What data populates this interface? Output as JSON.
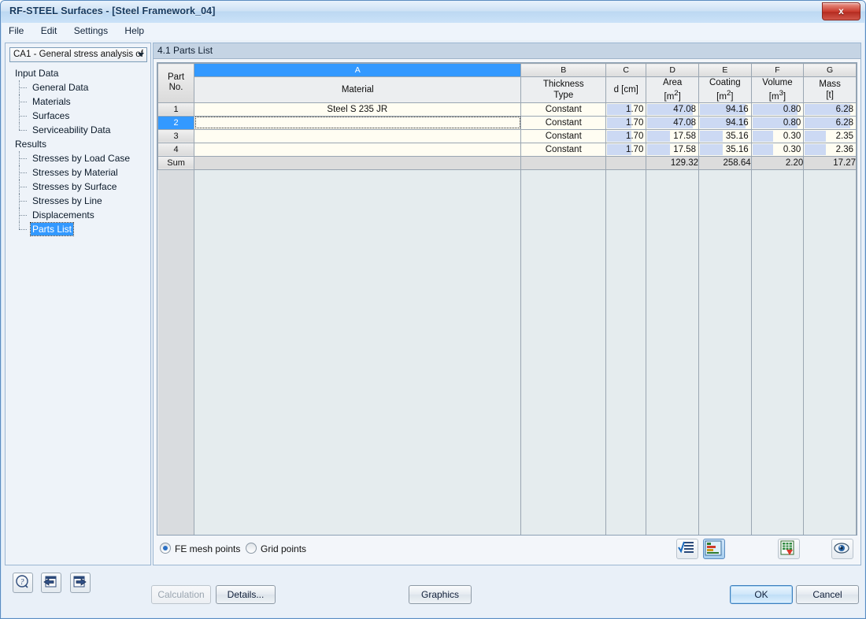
{
  "window": {
    "title": "RF-STEEL Surfaces - [Steel Framework_04]",
    "close_label": "x"
  },
  "menubar": {
    "items": [
      {
        "label": "File"
      },
      {
        "label": "Edit"
      },
      {
        "label": "Settings"
      },
      {
        "label": "Help"
      }
    ]
  },
  "sidebar": {
    "combo": {
      "value": "CA1 - General stress analysis of",
      "icon": "chevron-down-icon"
    },
    "tree": [
      {
        "label": "Input Data",
        "type": "root"
      },
      {
        "label": "General Data",
        "type": "child"
      },
      {
        "label": "Materials",
        "type": "child"
      },
      {
        "label": "Surfaces",
        "type": "child"
      },
      {
        "label": "Serviceability Data",
        "type": "child",
        "last": true
      },
      {
        "label": "Results",
        "type": "root"
      },
      {
        "label": "Stresses by Load Case",
        "type": "child"
      },
      {
        "label": "Stresses by Material",
        "type": "child"
      },
      {
        "label": "Stresses by Surface",
        "type": "child"
      },
      {
        "label": "Stresses by Line",
        "type": "child"
      },
      {
        "label": "Displacements",
        "type": "child"
      },
      {
        "label": "Parts List",
        "type": "child",
        "selected": true,
        "last": true
      }
    ],
    "buttons": [
      {
        "name": "help-button",
        "icon": "question-mark-icon"
      },
      {
        "name": "previous-button",
        "icon": "arrow-left-icon"
      },
      {
        "name": "next-button",
        "icon": "arrow-right-icon"
      }
    ]
  },
  "content": {
    "title": "4.1 Parts List",
    "table": {
      "column_letters": [
        "A",
        "B",
        "C",
        "D",
        "E",
        "F",
        "G"
      ],
      "selected_column_letter": "A",
      "row_header": {
        "line1": "Part",
        "line2": "No."
      },
      "headers": [
        {
          "line1": "",
          "line2": "Material"
        },
        {
          "line1": "Thickness",
          "line2": "Type"
        },
        {
          "line1": "",
          "line2": "d [cm]"
        },
        {
          "line1": "Area",
          "line2": "[m 2]"
        },
        {
          "line1": "Coating",
          "line2": "[m 2]"
        },
        {
          "line1": "Volume",
          "line2": "[m 3]"
        },
        {
          "line1": "Mass",
          "line2": "[t]"
        }
      ],
      "rows": [
        {
          "no": "1",
          "material": "Steel S 235 JR",
          "type": "Constant",
          "d": "1.70",
          "area": "47.08",
          "coating": "94.16",
          "volume": "0.80",
          "mass": "6.28",
          "selected": false,
          "editing": false,
          "bars": {
            "d": 62,
            "area": 88,
            "coating": 88,
            "volume": 88,
            "mass": 88
          }
        },
        {
          "no": "2",
          "material": "",
          "type": "Constant",
          "d": "1.70",
          "area": "47.08",
          "coating": "94.16",
          "volume": "0.80",
          "mass": "6.28",
          "selected": true,
          "editing": true,
          "bars": {
            "d": 62,
            "area": 88,
            "coating": 88,
            "volume": 88,
            "mass": 88
          }
        },
        {
          "no": "3",
          "material": "",
          "type": "Constant",
          "d": "1.70",
          "area": "17.58",
          "coating": "35.16",
          "volume": "0.30",
          "mass": "2.35",
          "selected": false,
          "editing": false,
          "bars": {
            "d": 62,
            "area": 44,
            "coating": 44,
            "volume": 40,
            "mass": 40
          }
        },
        {
          "no": "4",
          "material": "",
          "type": "Constant",
          "d": "1.70",
          "area": "17.58",
          "coating": "35.16",
          "volume": "0.30",
          "mass": "2.36",
          "selected": false,
          "editing": false,
          "bars": {
            "d": 62,
            "area": 44,
            "coating": 44,
            "volume": 40,
            "mass": 40
          }
        }
      ],
      "sum_row": {
        "label": "Sum",
        "material": "",
        "type": "",
        "d": "",
        "area": "129.32",
        "coating": "258.64",
        "volume": "2.20",
        "mass": "17.27"
      }
    },
    "options": {
      "radio_fe": {
        "label": "FE mesh points",
        "selected": true
      },
      "radio_grid": {
        "label": "Grid points",
        "selected": false
      },
      "tools": [
        {
          "name": "check-list-button",
          "icon": "checklist-icon",
          "active": false
        },
        {
          "name": "color-bars-button",
          "icon": "bar-chart-icon",
          "active": true
        },
        {
          "name": "export-excel-button",
          "icon": "excel-export-icon",
          "active": false
        },
        {
          "name": "view-button",
          "icon": "eye-icon",
          "active": false
        }
      ]
    }
  },
  "footer": {
    "calculation": {
      "label": "Calculation",
      "disabled": true
    },
    "details": {
      "label": "Details..."
    },
    "graphics": {
      "label": "Graphics"
    },
    "ok": {
      "label": "OK"
    },
    "cancel": {
      "label": "Cancel"
    }
  },
  "colors": {
    "accent_blue": "#3399ff",
    "bar_blue": "#ccd9f3",
    "data_row_bg": "#fffdf2",
    "sum_bg": "#dcdcdc",
    "title_text": "#16395e"
  }
}
